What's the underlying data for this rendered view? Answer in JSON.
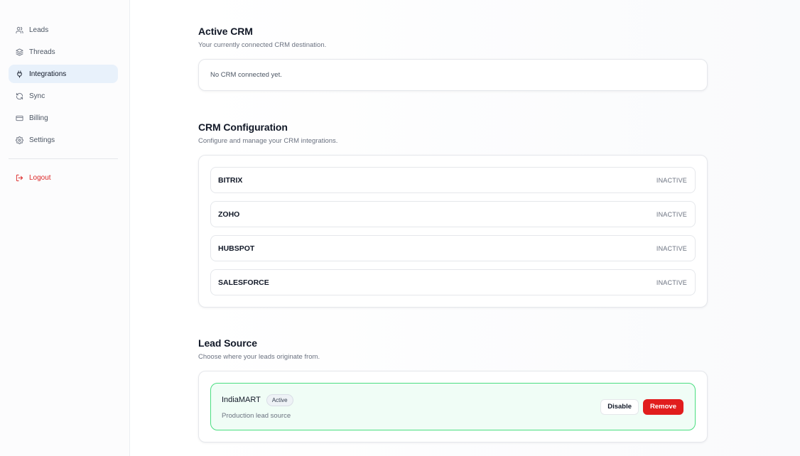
{
  "sidebar": {
    "items": [
      {
        "label": "Leads",
        "icon": "users-icon"
      },
      {
        "label": "Threads",
        "icon": "layers-icon"
      },
      {
        "label": "Integrations",
        "icon": "plug-icon",
        "active": true
      },
      {
        "label": "Sync",
        "icon": "refresh-icon"
      },
      {
        "label": "Billing",
        "icon": "credit-card-icon"
      },
      {
        "label": "Settings",
        "icon": "gear-icon"
      }
    ],
    "logout": {
      "label": "Logout",
      "icon": "logout-icon"
    }
  },
  "active_crm": {
    "title": "Active CRM",
    "subtitle": "Your currently connected CRM destination.",
    "empty_text": "No CRM connected yet."
  },
  "crm_config": {
    "title": "CRM Configuration",
    "subtitle": "Configure and manage your CRM integrations.",
    "items": [
      {
        "name": "BITRIX",
        "status": "INACTIVE"
      },
      {
        "name": "ZOHO",
        "status": "INACTIVE"
      },
      {
        "name": "HUBSPOT",
        "status": "INACTIVE"
      },
      {
        "name": "SALESFORCE",
        "status": "INACTIVE"
      }
    ]
  },
  "lead_source": {
    "title": "Lead Source",
    "subtitle": "Choose where your leads originate from.",
    "source": {
      "name": "IndiaMART",
      "badge": "Active",
      "description": "Production lead source",
      "disable_label": "Disable",
      "remove_label": "Remove"
    }
  },
  "colors": {
    "accent_active_bg": "#e8f1fb",
    "logout": "#dc2626",
    "success_border": "#4ade80",
    "danger": "#e11d1d"
  }
}
